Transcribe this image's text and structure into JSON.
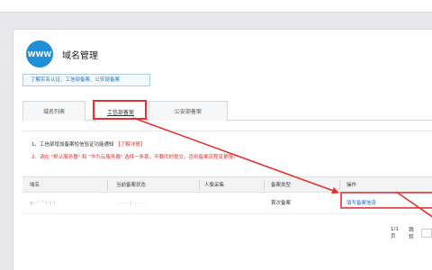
{
  "header": {
    "icon_text": "WWW",
    "title": "域名管理"
  },
  "notice": {
    "text": "了解实名认证、工信部备案、公安部备案"
  },
  "tabs": [
    {
      "label": "域名列表"
    },
    {
      "label": "工信部备案"
    },
    {
      "label": "公安部备案"
    }
  ],
  "messages": {
    "line1_text": "1、工信部增加备案短信验证功能通知",
    "line1_link": "【了解详情】",
    "line2_text": "2、请在 \"默认服务器\" 和 \"华为云服务器\" 选择一条套，不要同时提交，否则备案流程变更慢。"
  },
  "table": {
    "headers": [
      "域名",
      "当前备案状态",
      "人像采集",
      "备案类型",
      "操作"
    ],
    "rows": [
      {
        "domain": "g··'·\"'l.t·l",
        "status": "·······|·······",
        "face": "",
        "type": "首次备案",
        "action": "填写备案信息"
      }
    ]
  },
  "pager": {
    "page_info": "1/1页",
    "jump_label": "跳转"
  },
  "colors": {
    "accent_blue": "#1e8fd6",
    "highlight_red": "#e53232",
    "link_blue": "#1f6fc5"
  }
}
